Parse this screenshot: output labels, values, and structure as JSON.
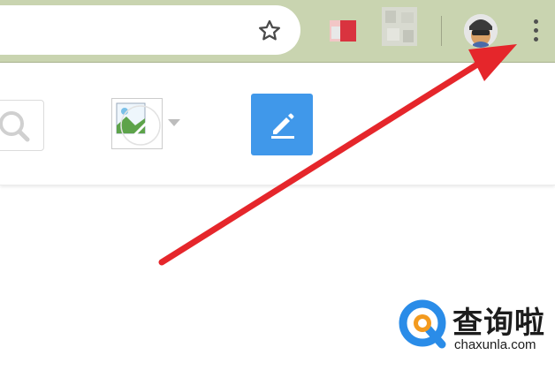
{
  "toolbar": {
    "icons": {
      "bookmark": "star-icon",
      "extension_1": "red-extension-icon",
      "extension_2": "blurred-extension-icon",
      "profile": "avatar",
      "menu": "kebab-menu-icon"
    },
    "colors": {
      "background": "#c9d4b0",
      "menu_dots": "#505050"
    }
  },
  "header": {
    "icons": {
      "search": "search-icon",
      "image": "image-icon",
      "dropdown": "caret-down-icon",
      "edit": "pencil-icon"
    },
    "colors": {
      "edit_button": "#4098ea"
    }
  },
  "annotation": {
    "type": "arrow",
    "points_to": "menu-icon",
    "color": "#e5262b"
  },
  "watermark": {
    "title": "查询啦",
    "url": "chaxunla.com",
    "colors": {
      "ring_blue": "#2a8ce8",
      "accent_orange": "#f39a1e"
    }
  }
}
